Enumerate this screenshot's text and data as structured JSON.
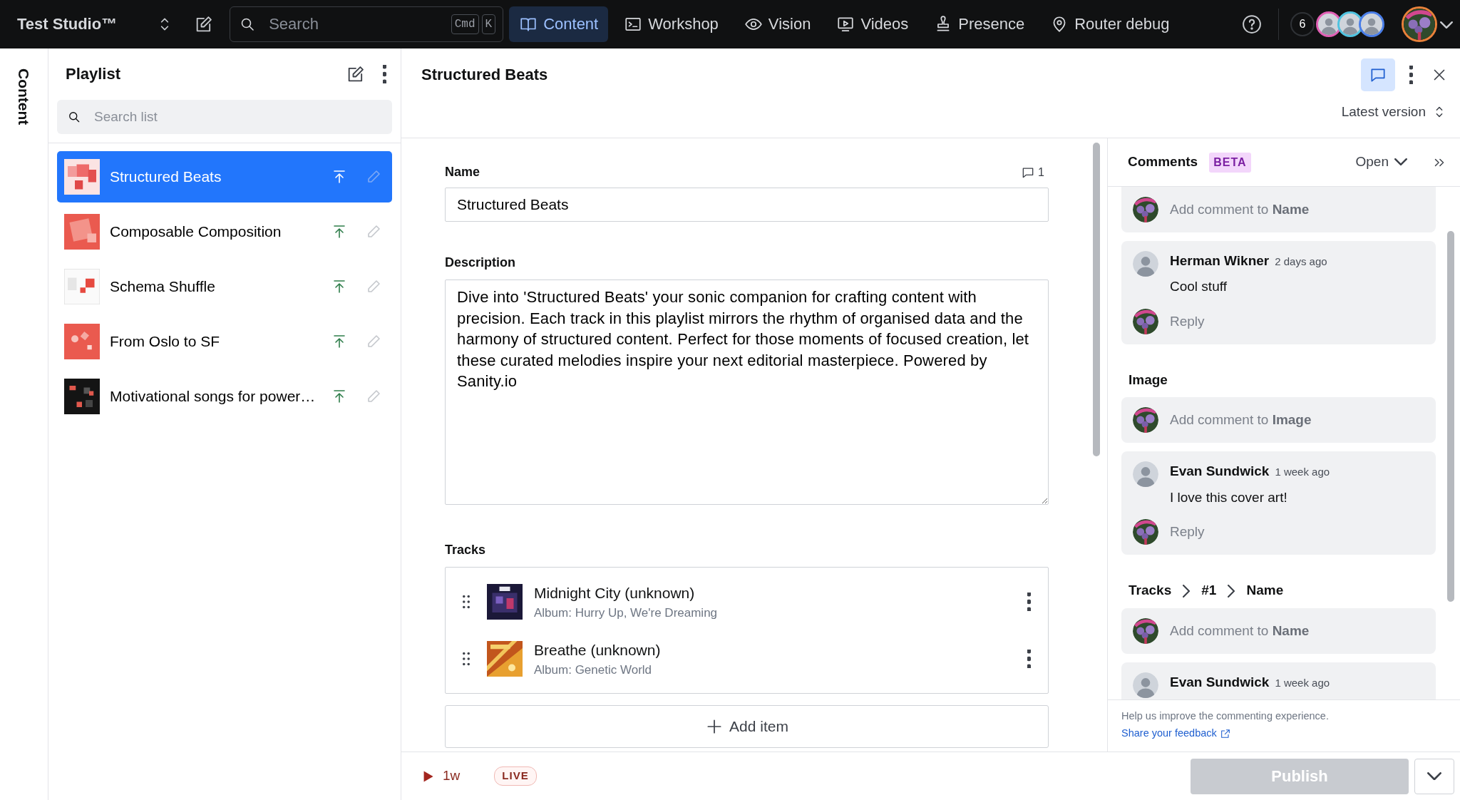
{
  "topbar": {
    "studio_name": "Test Studio™",
    "search": {
      "placeholder": "Search",
      "shortcut": [
        "Cmd",
        "K"
      ]
    },
    "tabs": [
      {
        "label": "Content",
        "kind": "book",
        "selected": true
      },
      {
        "label": "Workshop",
        "kind": "terminal",
        "selected": false
      },
      {
        "label": "Vision",
        "kind": "eye",
        "selected": false
      },
      {
        "label": "Videos",
        "kind": "video",
        "selected": false
      },
      {
        "label": "Presence",
        "kind": "stamp",
        "selected": false
      },
      {
        "label": "Router debug",
        "kind": "pin",
        "selected": false
      }
    ],
    "presence": {
      "count": "6",
      "avatars": [
        {
          "color": "#e05fb4"
        },
        {
          "color": "#4fc3e0"
        },
        {
          "color": "#4a7ee8"
        }
      ]
    },
    "user_avatar": {
      "color": "#e8813a"
    }
  },
  "sidebar_tab": {
    "label": "Content"
  },
  "playlist": {
    "title": "Playlist",
    "search": {
      "placeholder": "Search list"
    },
    "items": [
      {
        "title": "Structured Beats",
        "selected": true
      },
      {
        "title": "Composable Composition",
        "selected": false
      },
      {
        "title": "Schema Shuffle",
        "selected": false
      },
      {
        "title": "From Oslo to SF",
        "selected": false
      },
      {
        "title": "Motivational songs for power…",
        "selected": false
      }
    ]
  },
  "document": {
    "title": "Structured Beats",
    "comments_button_active": true,
    "version": "Latest version",
    "name": {
      "label": "Name",
      "comment_count": "1",
      "value": "Structured Beats"
    },
    "description": {
      "label": "Description",
      "value": "Dive into 'Structured Beats' your sonic companion for crafting content with precision. Each track in this playlist mirrors the rhythm of organised data and the harmony of structured content. Perfect for those moments of focused creation, let these curated melodies inspire your next editorial masterpiece. Powered by Sanity.io"
    },
    "tracks": {
      "label": "Tracks",
      "items": [
        {
          "title": "Midnight City (unknown)",
          "subtitle": "Album: Hurry Up, We're Dreaming"
        },
        {
          "title": "Breathe (unknown)",
          "subtitle": "Album: Genetic World"
        }
      ],
      "add_label": "Add item"
    }
  },
  "footer": {
    "age": "1w",
    "status": "LIVE",
    "publish": {
      "label": "Publish",
      "disabled": true
    }
  },
  "comments": {
    "title": "Comments",
    "badge": "BETA",
    "filter": "Open",
    "entries": [
      {
        "kind": "composer",
        "placeholder": "Add comment to **Name**"
      },
      {
        "kind": "thread",
        "author": "Herman Wikner",
        "time": "2 days ago",
        "text": "Cool stuff",
        "reply_placeholder": "Reply"
      },
      {
        "kind": "heading",
        "path": [
          "Image"
        ]
      },
      {
        "kind": "composer",
        "placeholder": "Add comment to **Image**"
      },
      {
        "kind": "thread",
        "author": "Evan Sundwick",
        "time": "1 week ago",
        "text": "I love this cover art!",
        "reply_placeholder": "Reply"
      },
      {
        "kind": "heading",
        "path": [
          "Tracks",
          "#1",
          "Name"
        ]
      },
      {
        "kind": "composer",
        "placeholder": "Add comment to **Name**"
      },
      {
        "kind": "thread",
        "author": "Evan Sundwick",
        "time": "1 week ago"
      }
    ],
    "feedback_text": "Help us improve the commenting experience.",
    "feedback_link": "Share your feedback"
  }
}
